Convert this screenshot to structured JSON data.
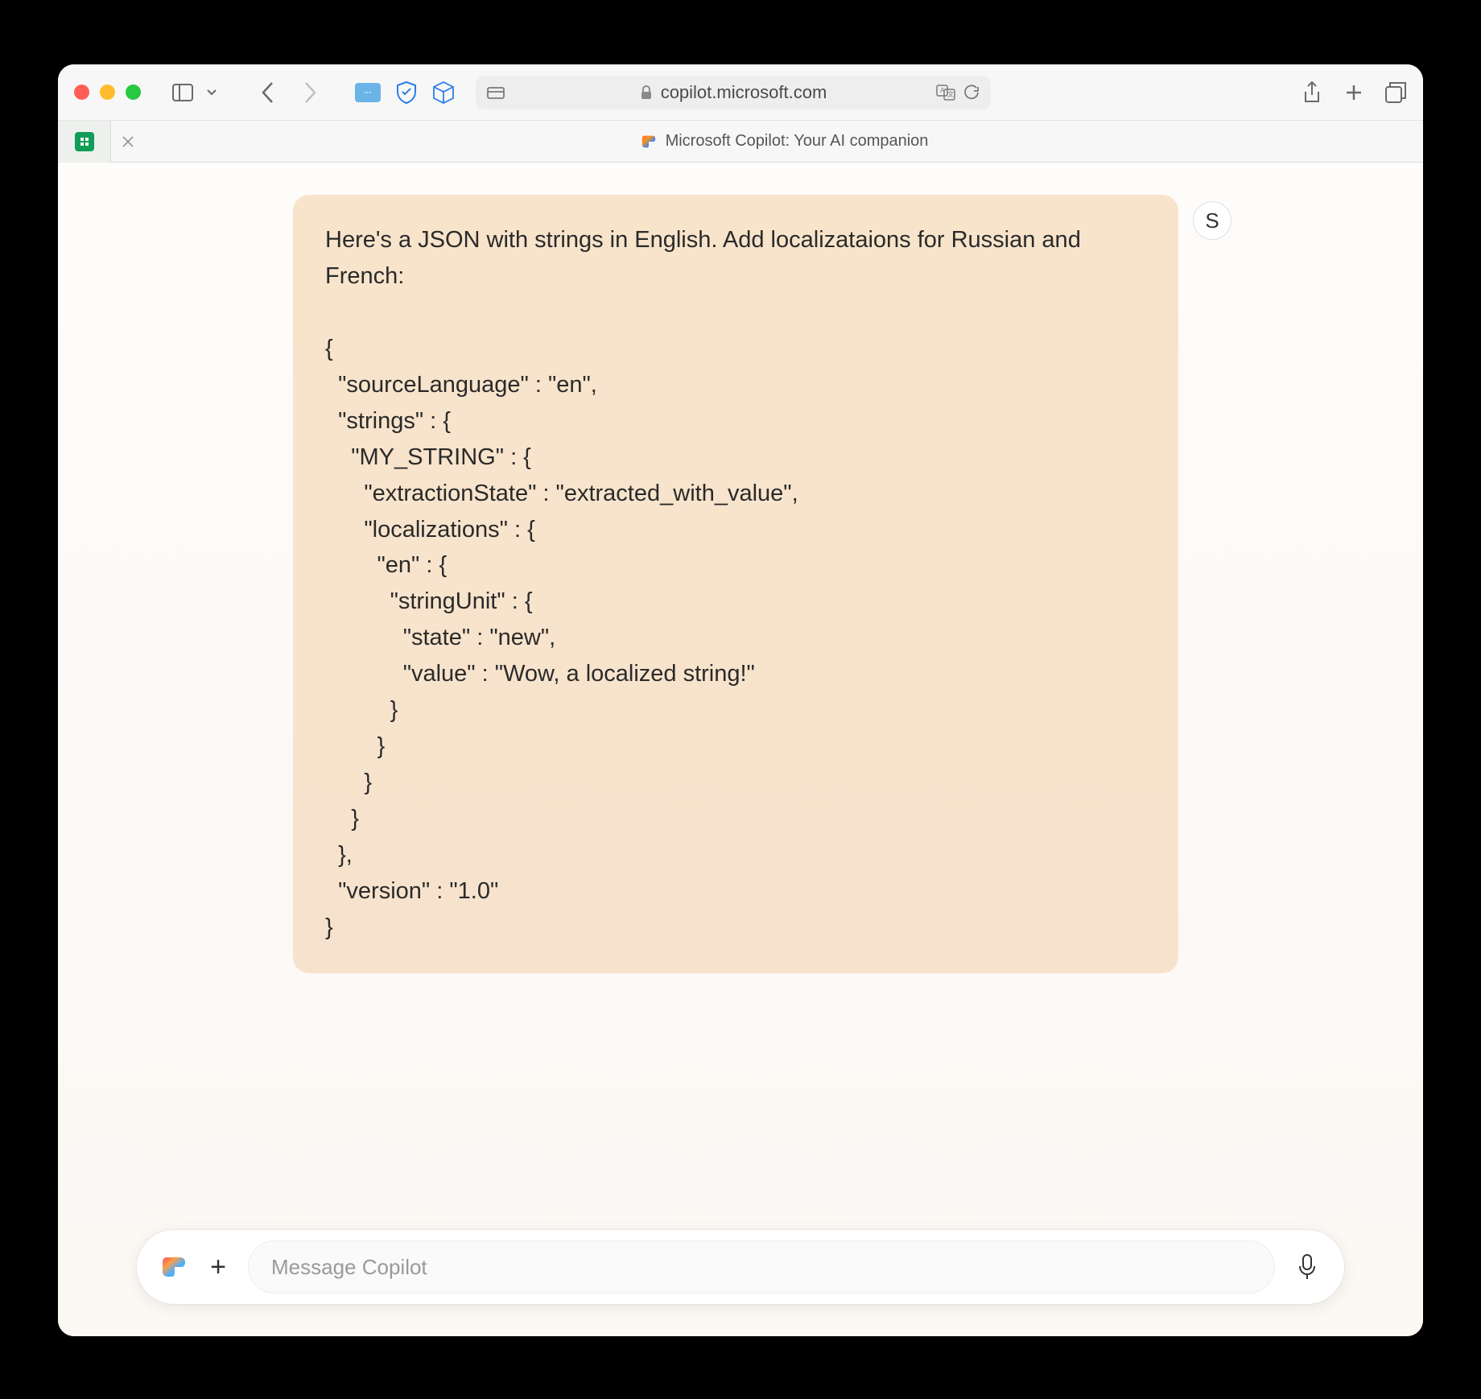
{
  "toolbar": {
    "url": "copilot.microsoft.com"
  },
  "tab": {
    "title": "Microsoft Copilot: Your AI companion"
  },
  "chat": {
    "avatar_letter": "S",
    "message": "Here's a JSON with strings in English. Add localizataions for Russian and French:\n\n{\n  \"sourceLanguage\" : \"en\",\n  \"strings\" : {\n    \"MY_STRING\" : {\n      \"extractionState\" : \"extracted_with_value\",\n      \"localizations\" : {\n        \"en\" : {\n          \"stringUnit\" : {\n            \"state\" : \"new\",\n            \"value\" : \"Wow, a localized string!\"\n          }\n        }\n      }\n    }\n  },\n  \"version\" : \"1.0\"\n}"
  },
  "input": {
    "placeholder": "Message Copilot"
  }
}
